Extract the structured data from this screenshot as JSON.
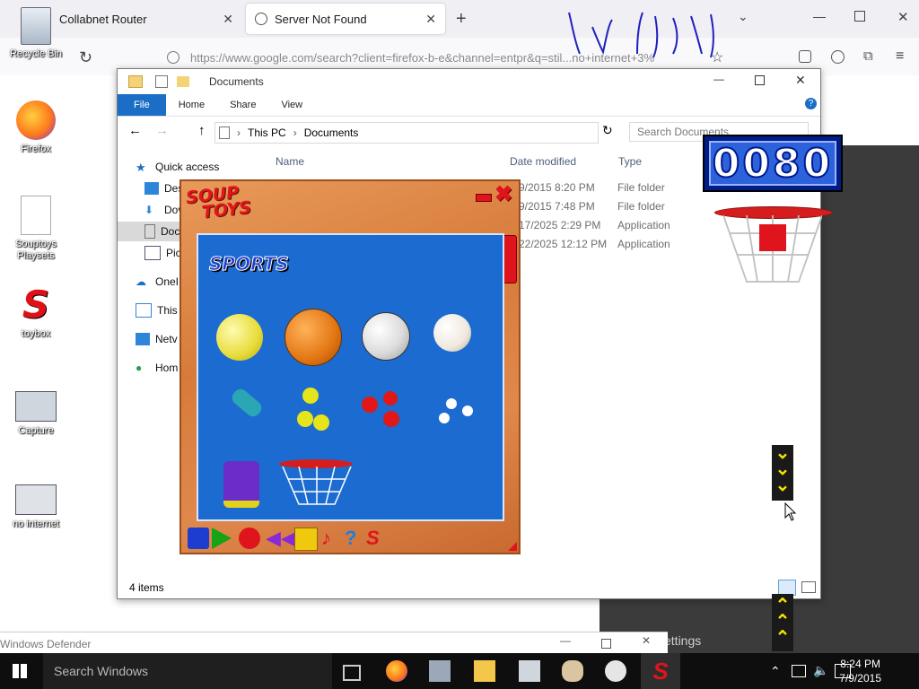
{
  "browser": {
    "tabs": [
      {
        "title": "Collabnet Router",
        "close": "✕"
      },
      {
        "title": "Server Not Found",
        "close": "✕"
      }
    ],
    "new_tab": "+",
    "url": "https://www.google.com/search?client=firefox-b-e&channel=entpr&q=stil...no+internet+3%"
  },
  "desktop": {
    "icons": [
      {
        "label": "Recycle Bin"
      },
      {
        "label": "Firefox"
      },
      {
        "label": "Souptoys Playsets"
      },
      {
        "label": "toybox"
      },
      {
        "label": "Capture"
      },
      {
        "label": "no internet"
      }
    ]
  },
  "explorer": {
    "title": "Documents",
    "ribbon_tabs": [
      "File",
      "Home",
      "Share",
      "View"
    ],
    "breadcrumb": [
      "This PC",
      "Documents"
    ],
    "search_placeholder": "Search Documents",
    "nav": [
      "Quick access",
      "Des",
      "Dov",
      "Doc",
      "Pic",
      "OneI",
      "This",
      "Netv",
      "Hom"
    ],
    "columns": [
      "Name",
      "Date modified",
      "Type"
    ],
    "rows": [
      {
        "date": "9/2015 8:20 PM",
        "type": "File folder"
      },
      {
        "date": "9/2015 7:48 PM",
        "type": "File folder"
      },
      {
        "date": "17/2025 2:29 PM",
        "type": "Application"
      },
      {
        "date": "22/2025 12:12 PM",
        "type": "Application"
      }
    ],
    "status": "4 items"
  },
  "souptoys": {
    "logo_line1": "SOUP",
    "logo_line2": "TOYS",
    "category": "SPORTS"
  },
  "score": {
    "value": "0080"
  },
  "defender": {
    "title": "Windows Defender"
  },
  "background_text": "ettings",
  "taskbar": {
    "search_placeholder": "Search Windows",
    "time": "8:24 PM",
    "date": "7/9/2015"
  },
  "colors": {
    "file_tab": "#1a6ec5",
    "play_area": "#1c6bd1",
    "score_bg": "#2d62dd"
  }
}
